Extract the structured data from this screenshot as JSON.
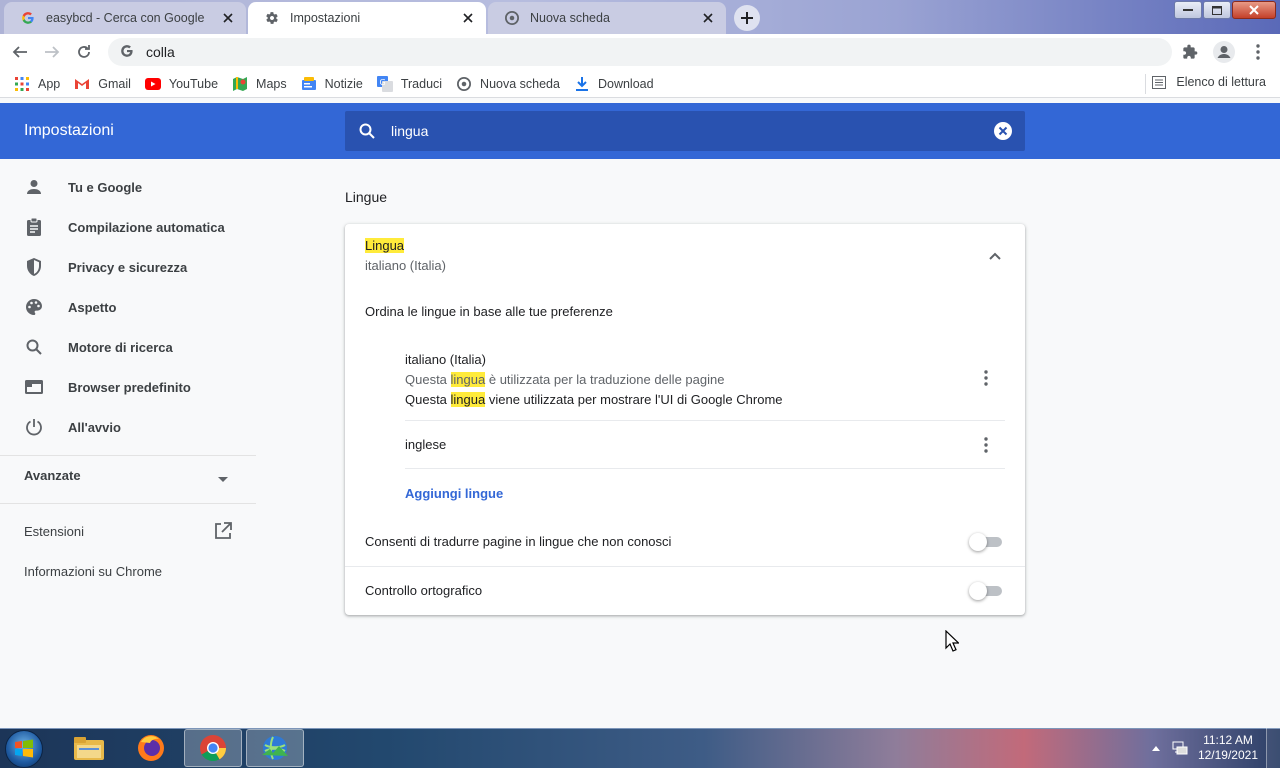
{
  "tabs": [
    {
      "title": "easybcd - Cerca con Google",
      "icon": "google-icon",
      "active": false
    },
    {
      "title": "Impostazioni",
      "icon": "gear-icon",
      "active": true
    },
    {
      "title": "Nuova scheda",
      "icon": "chrome-icon",
      "active": false
    }
  ],
  "omnibox": {
    "value": "colla"
  },
  "bookmarks": [
    {
      "label": "App",
      "icon": "apps-grid-icon"
    },
    {
      "label": "Gmail",
      "icon": "gmail-icon"
    },
    {
      "label": "YouTube",
      "icon": "youtube-icon"
    },
    {
      "label": "Maps",
      "icon": "maps-icon"
    },
    {
      "label": "Notizie",
      "icon": "news-icon"
    },
    {
      "label": "Traduci",
      "icon": "translate-icon"
    },
    {
      "label": "Nuova scheda",
      "icon": "globe-icon"
    },
    {
      "label": "Download",
      "icon": "download-icon"
    }
  ],
  "reading_list": "Elenco di lettura",
  "header": {
    "title": "Impostazioni",
    "search_value": "lingua"
  },
  "sidebar": {
    "items": [
      {
        "label": "Tu e Google",
        "icon": "person-icon"
      },
      {
        "label": "Compilazione automatica",
        "icon": "clipboard-icon"
      },
      {
        "label": "Privacy e sicurezza",
        "icon": "shield-icon"
      },
      {
        "label": "Aspetto",
        "icon": "palette-icon"
      },
      {
        "label": "Motore di ricerca",
        "icon": "search-icon"
      },
      {
        "label": "Browser predefinito",
        "icon": "browser-icon"
      },
      {
        "label": "All'avvio",
        "icon": "power-icon"
      }
    ],
    "advanced": "Avanzate",
    "extensions": "Estensioni",
    "about": "Informazioni su Chrome"
  },
  "main": {
    "section_title": "Lingue",
    "language": {
      "title_highlight": "Lingua",
      "current": "italiano (Italia)",
      "order_text": "Ordina le lingue in base alle tue preferenze",
      "languages": [
        {
          "name": "italiano (Italia)",
          "note1_pre": "Questa ",
          "note1_hl": "lingua",
          "note1_post": " è utilizzata per la traduzione delle pagine",
          "note2_pre": "Questa ",
          "note2_hl": "lingua",
          "note2_post": " viene utilizzata per mostrare l'UI di Google Chrome"
        },
        {
          "name": "inglese"
        }
      ],
      "add_languages": "Aggiungi lingue"
    },
    "settings": [
      {
        "label": "Consenti di tradurre pagine in lingue che non conosci",
        "enabled": false
      },
      {
        "label": "Controllo ortografico",
        "enabled": false
      }
    ]
  },
  "taskbar": {
    "apps": [
      "explorer-icon",
      "firefox-icon",
      "chrome-icon",
      "network-app-icon"
    ],
    "time": "11:12 AM",
    "date": "12/19/2021"
  },
  "colors": {
    "accent": "#3367d6",
    "header_search": "#2952b0",
    "highlight": "#ffeb3b"
  }
}
